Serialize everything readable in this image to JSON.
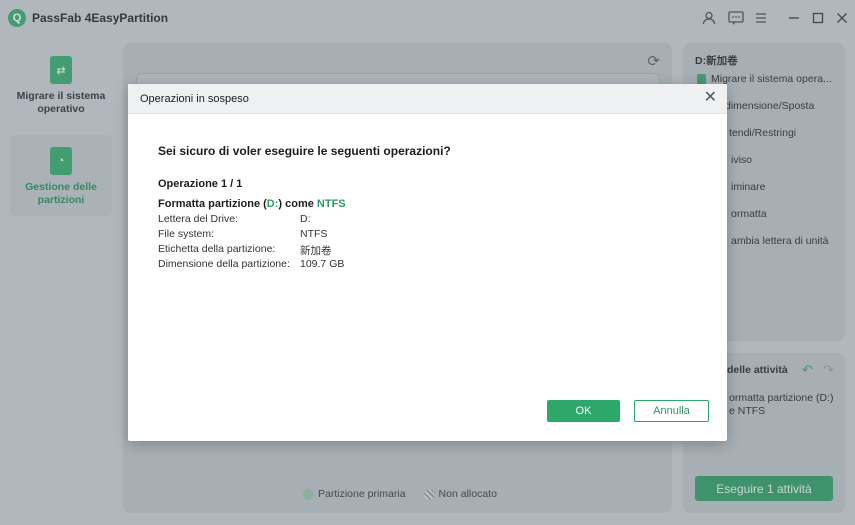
{
  "app": {
    "title": "PassFab 4EasyPartition",
    "logo_letter": "Q"
  },
  "titlebar": {
    "icons": [
      "user-icon",
      "feedback-icon",
      "menu-icon",
      "minimize-icon",
      "maximize-icon",
      "close-icon"
    ]
  },
  "nav": {
    "items": [
      {
        "label": "Migrare il sistema operativo",
        "icon": "migrate-os-icon",
        "active": false
      },
      {
        "label": "Gestione delle partizioni",
        "icon": "partition-icon",
        "active": true
      }
    ]
  },
  "legend": {
    "primary": "Partizione primaria",
    "unallocated": "Non allocato"
  },
  "right_panel": {
    "title": "D:新加卷",
    "items": [
      "Migrare il sistema opera...",
      "dimensione/Sposta",
      "tendi/Restringi",
      "iviso",
      "iminare",
      "ormatta",
      "ambia lettera di unità"
    ]
  },
  "task_panel": {
    "title": "delle attività",
    "task_line1": "ormatta partizione (D:)",
    "task_line2": "e NTFS",
    "execute_label": "Eseguire 1 attività"
  },
  "dialog": {
    "title": "Operazioni in sospeso",
    "question": "Sei sicuro di voler eseguire le seguenti operazioni?",
    "operation": "Operazione 1 / 1",
    "format_prefix": "Formatta partizione (",
    "format_drive": "D:",
    "format_mid": ") come ",
    "format_fs": "NTFS",
    "details": [
      {
        "label": "Lettera del Drive:",
        "value": "D:"
      },
      {
        "label": "File system:",
        "value": "NTFS"
      },
      {
        "label": "Etichetta della partizione:",
        "value": "新加卷"
      },
      {
        "label": "Dimensione della partizione:",
        "value": "109.7 GB"
      }
    ],
    "ok_label": "OK",
    "cancel_label": "Annulla"
  },
  "colors": {
    "accent": "#2ea86a",
    "accent_dark": "#2a9a62"
  }
}
